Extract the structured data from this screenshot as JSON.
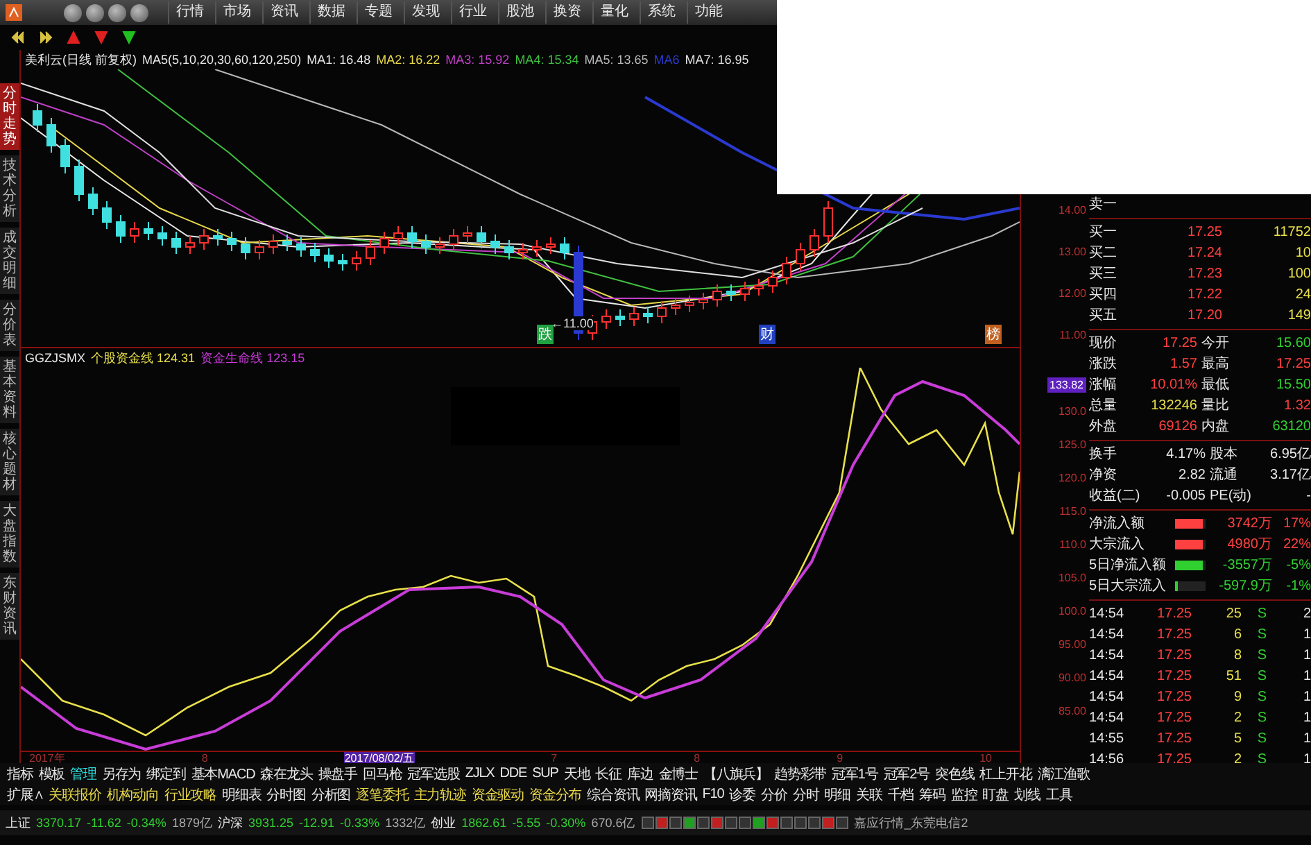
{
  "menu": {
    "items": [
      {
        "label": "行情"
      },
      {
        "label": "市场"
      },
      {
        "label": "资讯"
      },
      {
        "label": "数据"
      },
      {
        "label": "专题"
      },
      {
        "label": "发现"
      },
      {
        "label": "行业"
      },
      {
        "label": "股池"
      },
      {
        "label": "换资"
      },
      {
        "label": "量化"
      },
      {
        "label": "系统"
      },
      {
        "label": "功能"
      }
    ]
  },
  "side_tabs": [
    {
      "label": "分时走势",
      "selected": true
    },
    {
      "label": "技术分析",
      "selected": false
    },
    {
      "label": "成交明细",
      "selected": false
    },
    {
      "label": "分价表",
      "selected": false
    },
    {
      "label": "基本资料",
      "selected": false
    },
    {
      "label": "核心题材",
      "selected": false
    },
    {
      "label": "大盘指数",
      "selected": false
    },
    {
      "label": "东财资讯",
      "selected": false
    }
  ],
  "price_chart": {
    "title": "美利云(日线 前复权)",
    "params": "MA5(5,10,20,30,60,120,250)",
    "ma": [
      {
        "label": "MA1: 16.48",
        "color": "#e8e8e8"
      },
      {
        "label": "MA2: 16.22",
        "color": "#e8d84a"
      },
      {
        "label": "MA3: 15.92",
        "color": "#c040c8"
      },
      {
        "label": "MA4: 15.34",
        "color": "#40c040"
      },
      {
        "label": "MA5: 13.65",
        "color": "#b8b8b8"
      },
      {
        "label": "MA6",
        "color": "#2a3ad0"
      },
      {
        "label": "MA7: 16.95",
        "color": "#e0e0e0"
      }
    ],
    "low_label": "←11.00",
    "markers": [
      {
        "label": "跌",
        "kind": "fall"
      },
      {
        "label": "财",
        "kind": "finance"
      },
      {
        "label": "榜",
        "kind": "rank"
      }
    ],
    "axis": [
      "14.00",
      "13.00",
      "12.00",
      "11.00"
    ]
  },
  "indicator": {
    "name": "GGZJSMX",
    "lines": [
      {
        "label": "个股资金线",
        "value": "124.31",
        "color": "#e8e04a"
      },
      {
        "label": "资金生命线",
        "value": "123.15",
        "color": "#c83cd8"
      }
    ],
    "current": "133.82",
    "axis": [
      "130.0",
      "125.0",
      "120.0",
      "115.0",
      "110.0",
      "105.0",
      "100.0",
      "95.00",
      "90.00",
      "85.00"
    ]
  },
  "dates": [
    {
      "label": "2017年",
      "selected": false
    },
    {
      "label": "8",
      "selected": false
    },
    {
      "label": "2017/08/02/五",
      "selected": true
    },
    {
      "label": "7",
      "selected": false
    },
    {
      "label": "8",
      "selected": false
    },
    {
      "label": "9",
      "selected": false
    },
    {
      "label": "10",
      "selected": false
    }
  ],
  "quote": {
    "sell": [
      {
        "label": "卖一"
      }
    ],
    "buy": [
      {
        "label": "买一",
        "price": "17.25",
        "volume": "11752"
      },
      {
        "label": "买二",
        "price": "17.24",
        "volume": "10"
      },
      {
        "label": "买三",
        "price": "17.23",
        "volume": "100"
      },
      {
        "label": "买四",
        "price": "17.22",
        "volume": "24"
      },
      {
        "label": "买五",
        "price": "17.20",
        "volume": "149"
      }
    ],
    "stats": [
      {
        "items": [
          {
            "label": "现价",
            "value": "17.25",
            "color": "#ff4040"
          },
          {
            "label": "今开",
            "value": "15.60",
            "color": "#30d030"
          }
        ]
      },
      {
        "items": [
          {
            "label": "涨跌",
            "value": "1.57",
            "color": "#ff4040"
          },
          {
            "label": "最高",
            "value": "17.25",
            "color": "#ff4040"
          }
        ]
      },
      {
        "items": [
          {
            "label": "涨幅",
            "value": "10.01%",
            "color": "#ff4040"
          },
          {
            "label": "最低",
            "value": "15.50",
            "color": "#30d030"
          }
        ]
      },
      {
        "items": [
          {
            "label": "总量",
            "value": "132246",
            "color": "#e8e04a"
          },
          {
            "label": "量比",
            "value": "1.32",
            "color": "#ff4040"
          }
        ]
      },
      {
        "items": [
          {
            "label": "外盘",
            "value": "69126",
            "color": "#ff4040"
          },
          {
            "label": "内盘",
            "value": "63120",
            "color": "#30d030"
          }
        ]
      }
    ],
    "capital": [
      {
        "label": "换手",
        "value": "4.17%",
        "label2": "股本",
        "value2": "6.95亿"
      },
      {
        "label": "净资",
        "value": "2.82",
        "label2": "流通",
        "value2": "3.17亿"
      },
      {
        "label": "收益(二)",
        "value": "-0.005",
        "label2": "PE(动)",
        "value2": "-"
      }
    ],
    "flows": [
      {
        "label": "净流入额",
        "color": "#ff4040",
        "level": 0.9,
        "amount": "3742万",
        "pct": "17%"
      },
      {
        "label": "大宗流入",
        "color": "#ff4040",
        "level": 0.9,
        "amount": "4980万",
        "pct": "22%"
      },
      {
        "label": "5日净流入额",
        "color": "#30d030",
        "level": 0.9,
        "amount": "-3557万",
        "pct": "-5%"
      },
      {
        "label": "5日大宗流入",
        "color": "#30d030",
        "level": 0.1,
        "amount": "-597.9万",
        "pct": "-1%"
      }
    ],
    "trades": [
      {
        "time": "14:54",
        "price": "17.25",
        "volume": "25",
        "side": "S",
        "count": "2"
      },
      {
        "time": "14:54",
        "price": "17.25",
        "volume": "6",
        "side": "S",
        "count": "1"
      },
      {
        "time": "14:54",
        "price": "17.25",
        "volume": "8",
        "side": "S",
        "count": "1"
      },
      {
        "time": "14:54",
        "price": "17.25",
        "volume": "51",
        "side": "S",
        "count": "1"
      },
      {
        "time": "14:54",
        "price": "17.25",
        "volume": "9",
        "side": "S",
        "count": "1"
      },
      {
        "time": "14:54",
        "price": "17.25",
        "volume": "2",
        "side": "S",
        "count": "1"
      },
      {
        "time": "14:55",
        "price": "17.25",
        "volume": "5",
        "side": "S",
        "count": "1"
      },
      {
        "time": "14:56",
        "price": "17.25",
        "volume": "2",
        "side": "S",
        "count": "1"
      }
    ]
  },
  "toolbar": [
    {
      "label": "指标",
      "selected": false
    },
    {
      "label": "模板",
      "selected": false
    },
    {
      "label": "管理",
      "selected": true
    },
    {
      "label": "另存为",
      "selected": false
    },
    {
      "label": "绑定到",
      "selected": false
    },
    {
      "label": "基本MACD",
      "selected": false
    },
    {
      "label": "森在龙头",
      "selected": false
    },
    {
      "label": "操盘手",
      "selected": false
    },
    {
      "label": "回马枪",
      "selected": false
    },
    {
      "label": "冠军选股",
      "selected": false
    },
    {
      "label": "ZJLX",
      "selected": false
    },
    {
      "label": "DDE",
      "selected": false
    },
    {
      "label": "SUP",
      "selected": false
    },
    {
      "label": "天地",
      "selected": false
    },
    {
      "label": "长征",
      "selected": false
    },
    {
      "label": "库边",
      "selected": false
    },
    {
      "label": "金博士",
      "selected": false
    },
    {
      "label": "【八旗兵】",
      "selected": false
    },
    {
      "label": "趋势彩带",
      "selected": false
    },
    {
      "label": "冠军1号",
      "selected": false
    },
    {
      "label": "冠军2号",
      "selected": false
    },
    {
      "label": "突色线",
      "selected": false
    },
    {
      "label": "杠上开花",
      "selected": false
    },
    {
      "label": "漓江渔歌",
      "selected": false
    }
  ],
  "panel_tabs": [
    {
      "label": "扩展∧",
      "kind": "plain"
    },
    {
      "label": "关联报价",
      "kind": "accent"
    },
    {
      "label": "机构动向",
      "kind": "accent"
    },
    {
      "label": "行业攻略",
      "kind": "accent"
    },
    {
      "label": "明细表",
      "kind": "plain"
    },
    {
      "label": "分时图",
      "kind": "plain"
    },
    {
      "label": "分析图",
      "kind": "plain"
    },
    {
      "label": "逐笔委托",
      "kind": "accent"
    },
    {
      "label": "主力轨迹",
      "kind": "accent"
    },
    {
      "label": "资金驱动",
      "kind": "accent"
    },
    {
      "label": "资金分布",
      "kind": "accent"
    },
    {
      "label": "综合资讯",
      "kind": "plain"
    },
    {
      "label": "网摘资讯",
      "kind": "plain"
    },
    {
      "label": "F10",
      "kind": "plain"
    },
    {
      "label": "诊委",
      "kind": "plain"
    },
    {
      "label": "分价",
      "kind": "plain"
    },
    {
      "label": "分时",
      "kind": "plain"
    },
    {
      "label": "明细",
      "kind": "plain"
    },
    {
      "label": "关联",
      "kind": "plain"
    },
    {
      "label": "千档",
      "kind": "plain"
    },
    {
      "label": "筹码",
      "kind": "plain"
    },
    {
      "label": "监控",
      "kind": "plain"
    },
    {
      "label": "盯盘",
      "kind": "plain"
    },
    {
      "label": "划线",
      "kind": "plain"
    },
    {
      "label": "工具",
      "kind": "plain"
    }
  ],
  "status": {
    "indices": [
      {
        "name": "上证",
        "value": "3370.17",
        "change": "-11.62",
        "pct": "-0.34%",
        "amount": "1879亿"
      },
      {
        "name": "沪深",
        "value": "3931.25",
        "change": "-12.91",
        "pct": "-0.33%",
        "amount": "1332亿"
      },
      {
        "name": "创业",
        "value": "1862.61",
        "change": "-5.55",
        "pct": "-0.30%",
        "amount": "670.6亿"
      }
    ],
    "server": "嘉应行情_东莞电信2"
  }
}
